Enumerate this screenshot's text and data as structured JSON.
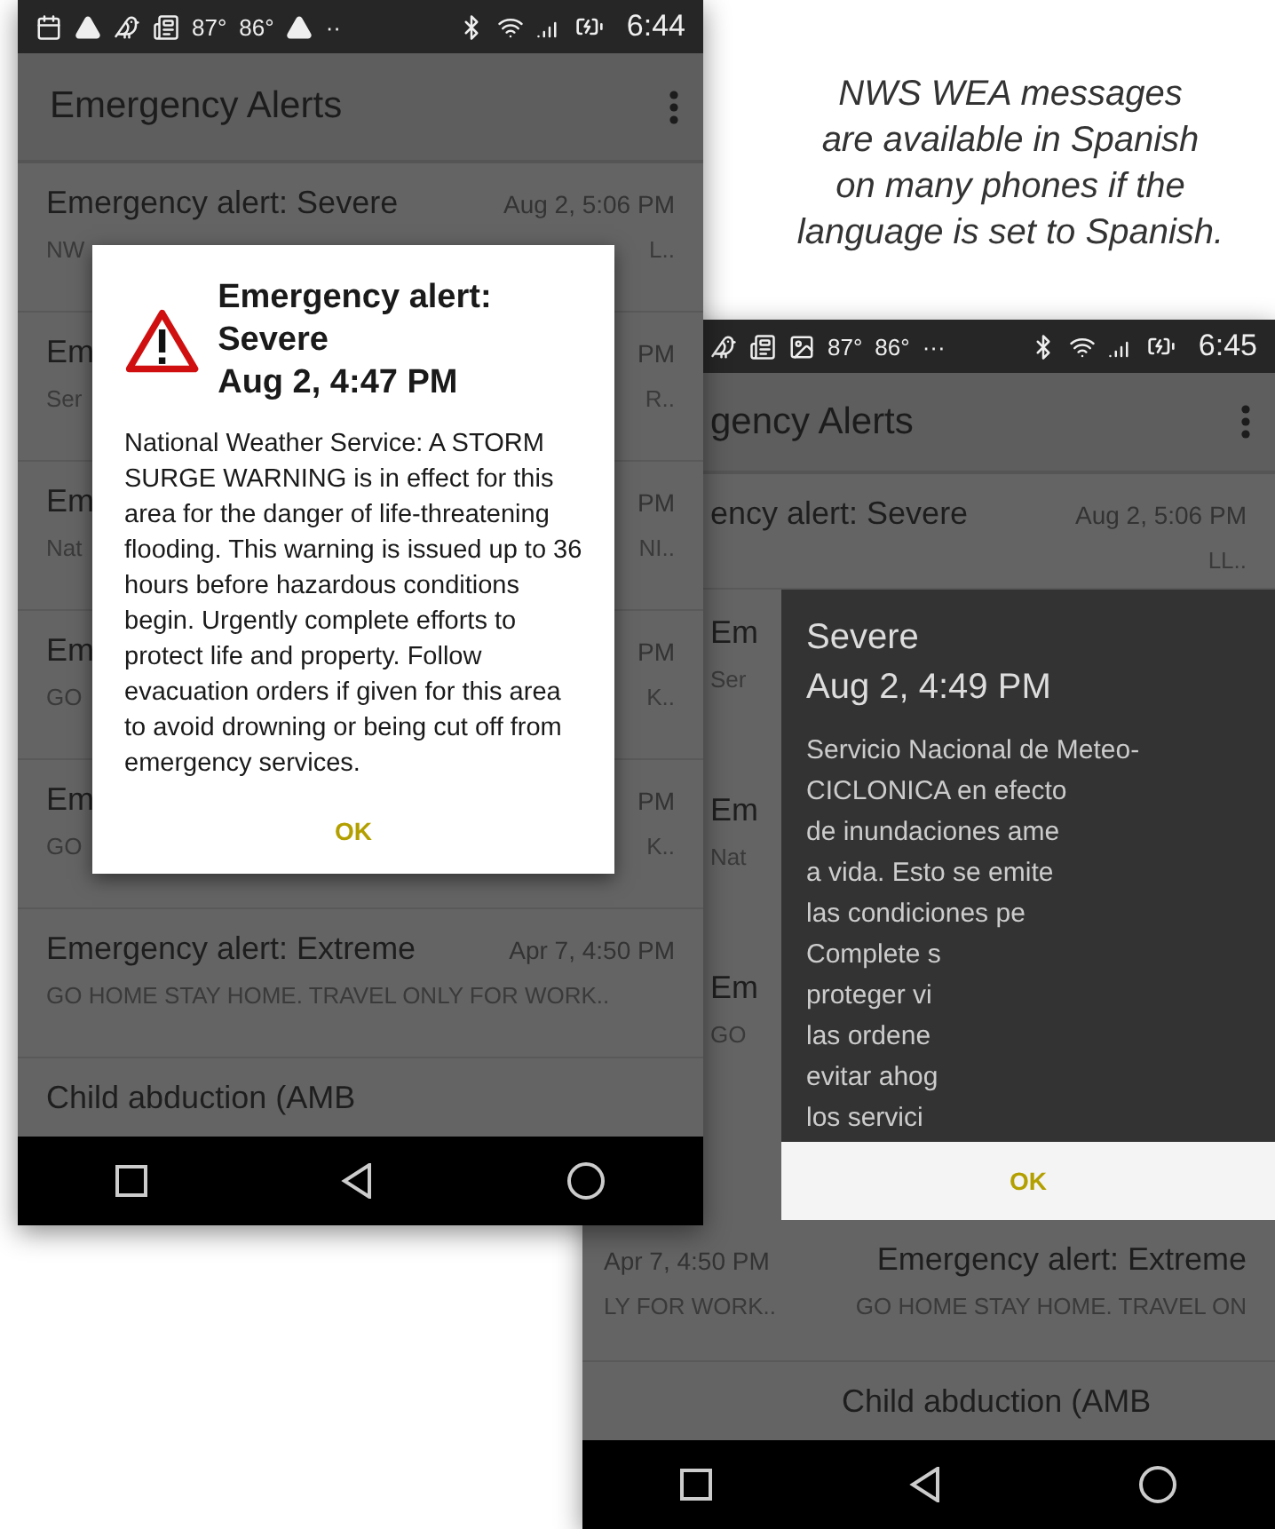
{
  "caption": {
    "lines": [
      "NWS WEA messages",
      "are available in Spanish",
      "on many phones if the",
      "language is set to Spanish."
    ]
  },
  "phone_1": {
    "status_bar": {
      "temps": [
        "87°",
        "86°"
      ],
      "more": "··",
      "time": "6:44"
    },
    "app_bar": {
      "title": "Emergency Alerts"
    },
    "rows": [
      {
        "title": "Emergency alert: Severe",
        "date": "Aug 2, 5:06 PM",
        "preview": "NW",
        "preview_end": "L.."
      },
      {
        "title": "Em",
        "date": "PM",
        "preview": "Ser",
        "preview_end": "R.."
      },
      {
        "title": "Em",
        "date": "PM",
        "preview": "Nat",
        "preview_end": "NI.."
      },
      {
        "title": "Em",
        "date": "PM",
        "preview": "GO",
        "preview_end": "K.."
      },
      {
        "title": "Em",
        "date": "PM",
        "preview": "GO",
        "preview_end": "K.."
      },
      {
        "title": "Emergency alert: Extreme",
        "date": "Apr 7, 4:50 PM",
        "preview": "GO HOME STAY HOME. TRAVEL ONLY FOR WORK..",
        "preview_end": ""
      },
      {
        "title": "Child abduction (AMB",
        "date": "",
        "preview": "",
        "preview_end": ""
      }
    ],
    "dialog": {
      "title": "Emergency alert: Severe",
      "time": "Aug 2, 4:47 PM",
      "body": "National Weather Service: A STORM SURGE WARNING is in effect for this area for the danger of life-threatening flooding. This warning is issued up to 36 hours before hazardous conditions begin. Urgently complete efforts to protect life and property. Follow evacuation orders if given for this area to avoid drowning or being cut off from emergency services.",
      "button": "OK"
    }
  },
  "phone_2": {
    "status_bar": {
      "temps": [
        "87°",
        "86°"
      ],
      "more": "···",
      "time": "6:45"
    },
    "app_bar": {
      "title": "gency Alerts"
    },
    "first_row": {
      "title": "ency alert: Severe",
      "date": "Aug 2, 5:06 PM",
      "preview_end": "LL.."
    },
    "side_rows": [
      {
        "title": "Em",
        "preview": "Ser"
      },
      {
        "title": "Em",
        "preview": "Nat"
      },
      {
        "title": "Em",
        "preview": "GO"
      }
    ],
    "dialog": {
      "title": "Severe",
      "time": "Aug 2, 4:49 PM",
      "lines": [
        "Servicio Nacional de Meteo-",
        "CICLONICA en efecto",
        "de inundaciones ame",
        "a vida. Esto se emite",
        "las condiciones pe",
        "Complete s",
        "proteger vi",
        "las ordene",
        "evitar ahog",
        "los servici"
      ],
      "button": "OK"
    },
    "extreme_row": {
      "date": "Apr 7, 4:50 PM",
      "title": "Emergency alert: Extreme",
      "preview_start": "LY FOR WORK..",
      "preview": "GO HOME STAY HOME. TRAVEL ON"
    },
    "last_row": {
      "title": "Child abduction (AMB"
    }
  }
}
